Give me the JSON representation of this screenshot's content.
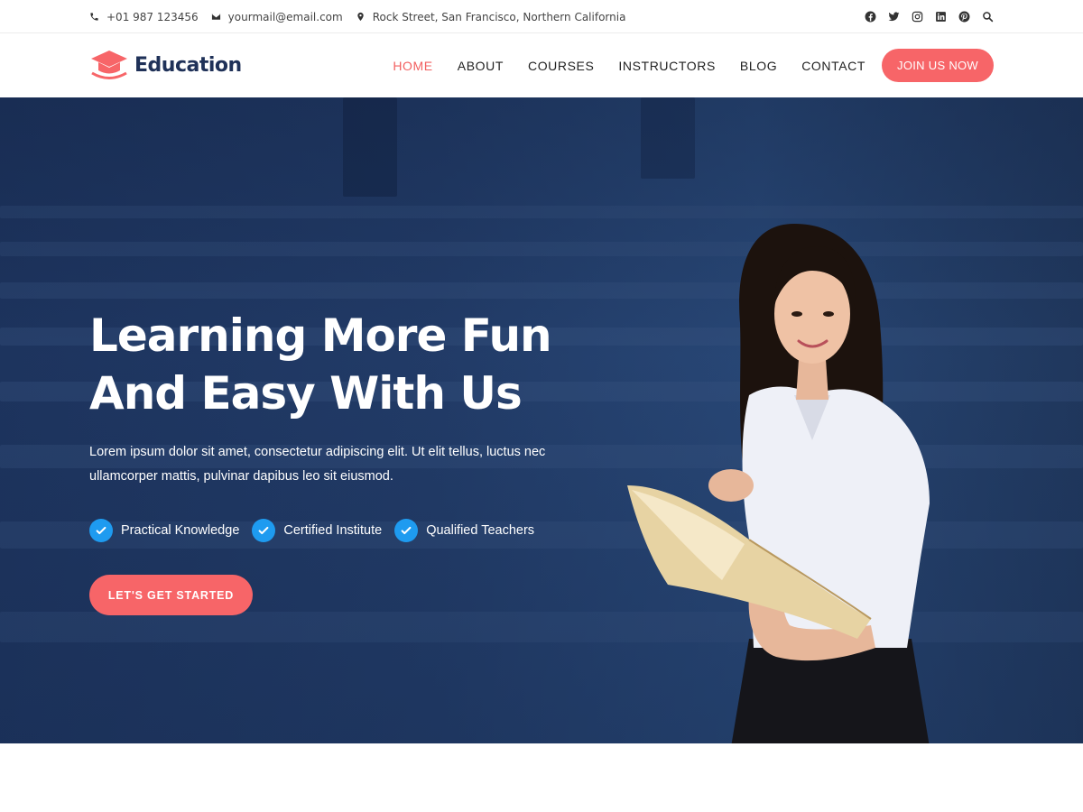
{
  "topbar": {
    "phone": "+01 987 123456",
    "email": "yourmail@email.com",
    "address": "Rock Street, San Francisco, Northern California",
    "social_icons": [
      "facebook-icon",
      "twitter-icon",
      "instagram-icon",
      "linkedin-icon",
      "pinterest-icon",
      "search-icon"
    ]
  },
  "header": {
    "brand": "Education",
    "nav": [
      {
        "label": "HOME",
        "active": true
      },
      {
        "label": "ABOUT",
        "active": false
      },
      {
        "label": "COURSES",
        "active": false
      },
      {
        "label": "INSTRUCTORS",
        "active": false
      },
      {
        "label": "BLOG",
        "active": false
      },
      {
        "label": "CONTACT",
        "active": false
      }
    ],
    "join_label": "JOIN US NOW"
  },
  "hero": {
    "title_line1": "Learning More Fun",
    "title_line2": "And Easy With Us",
    "description": "Lorem ipsum dolor sit amet, consectetur adipiscing elit. Ut elit tellus, luctus nec ullamcorper mattis, pulvinar dapibus leo sit eiusmod.",
    "features": [
      "Practical Knowledge",
      "Certified Institute",
      "Qualified Teachers"
    ],
    "cta_label": "LET'S GET STARTED"
  },
  "colors": {
    "accent": "#f76568",
    "brand_navy": "#1f3158",
    "hero_bg": "#233d6a",
    "check_blue": "#1e9bf0"
  }
}
